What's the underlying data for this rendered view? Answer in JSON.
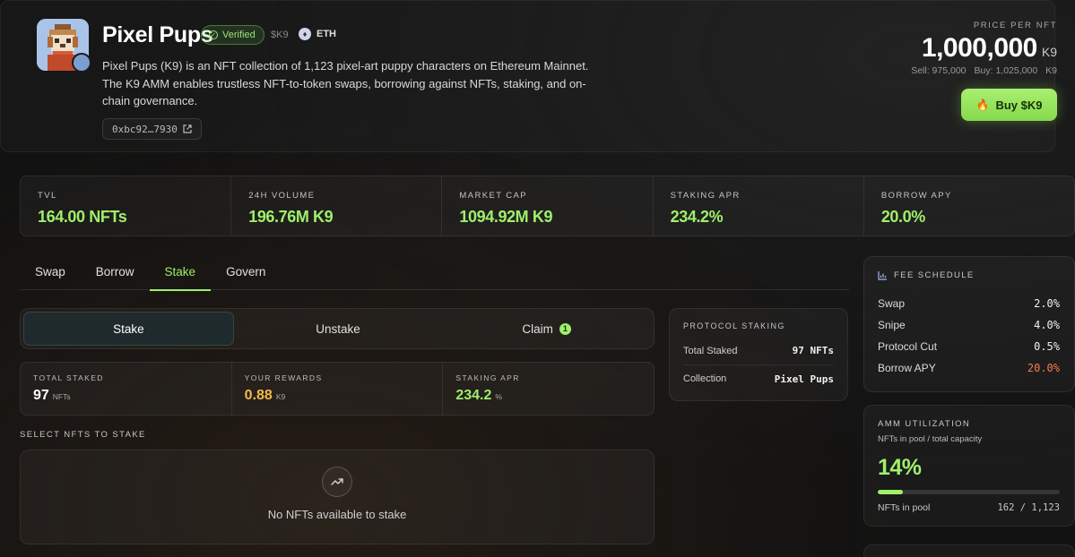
{
  "collection": {
    "name": "Pixel Pups",
    "verified_label": "Verified",
    "ticker": "$K9",
    "chain": "ETH",
    "description": "Pixel Pups (K9) is an NFT collection of 1,123 pixel-art puppy characters on Ethereum Mainnet. The K9 AMM enables trustless NFT-to-token swaps, borrowing against NFTs, staking, and on-chain governance.",
    "address": "0xbc92…7930"
  },
  "price": {
    "label": "PRICE PER NFT",
    "value": "1,000,000",
    "unit": "K9",
    "sell": "Sell: 975,000",
    "buy": "Buy: 1,025,000",
    "sub_unit": "K9"
  },
  "buy_button": {
    "label": "Buy $K9",
    "icon": "fire-icon"
  },
  "stats": [
    {
      "label": "TVL",
      "value": "164.00 NFTs"
    },
    {
      "label": "24H VOLUME",
      "value": "196.76M K9"
    },
    {
      "label": "MARKET CAP",
      "value": "1094.92M K9"
    },
    {
      "label": "STAKING APR",
      "value": "234.2%"
    },
    {
      "label": "BORROW APY",
      "value": "20.0%"
    }
  ],
  "tabs": [
    {
      "label": "Swap"
    },
    {
      "label": "Borrow"
    },
    {
      "label": "Stake",
      "active": true
    },
    {
      "label": "Govern"
    }
  ],
  "stake_modes": [
    {
      "label": "Stake",
      "active": true
    },
    {
      "label": "Unstake"
    },
    {
      "label": "Claim",
      "badge": "1"
    }
  ],
  "mini_stats": [
    {
      "label": "TOTAL STAKED",
      "value": "97",
      "unit": "NFTs",
      "color": "#ffffff"
    },
    {
      "label": "YOUR REWARDS",
      "value": "0.88",
      "unit": "K9",
      "color": "#f2b84b"
    },
    {
      "label": "STAKING APR",
      "value": "234.2",
      "unit": "%",
      "color": "#9ff06a"
    }
  ],
  "select_label": "SELECT NFTS TO STAKE",
  "empty_state": {
    "icon": "trending-up-icon",
    "text": "No NFTs available to stake"
  },
  "protocol_staking": {
    "title": "PROTOCOL STAKING",
    "rows": [
      {
        "label": "Total Staked",
        "value": "97 NFTs"
      },
      {
        "label": "Collection",
        "value": "Pixel Pups"
      }
    ]
  },
  "fee_schedule": {
    "title": "FEE SCHEDULE",
    "icon": "bar-chart-icon",
    "rows": [
      {
        "label": "Swap",
        "value": "2.0%",
        "color": "#f0f0f0"
      },
      {
        "label": "Snipe",
        "value": "4.0%",
        "color": "#f0f0f0"
      },
      {
        "label": "Protocol Cut",
        "value": "0.5%",
        "color": "#f0f0f0"
      },
      {
        "label": "Borrow APY",
        "value": "20.0%",
        "color": "#f57c4a"
      }
    ]
  },
  "amm": {
    "title": "AMM UTILIZATION",
    "subtitle": "NFTs in pool / total capacity",
    "percent_text": "14%",
    "fill_fraction": 0.14,
    "foot_label": "NFTs in pool",
    "foot_value": "162 / 1,123"
  },
  "colors": {
    "accent": "#9ff06a",
    "rewards": "#f2b84b",
    "warning": "#f57c4a"
  }
}
